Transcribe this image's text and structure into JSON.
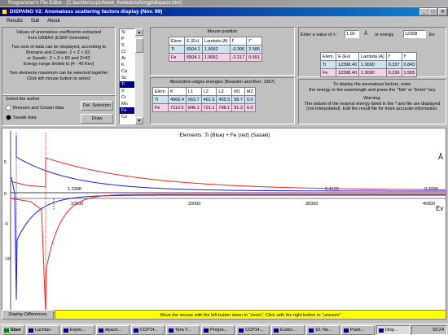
{
  "outer_window": {
    "title": "Programmer's File Editor - [C:\\lachlan\\ccp14\\web_live\\tutorial\\lmgp\\dispano.htm]"
  },
  "window": {
    "title": "DISPANO V2: Anomalous scattering factors display (Nov. 99)"
  },
  "menu": {
    "results": "Results",
    "sub": "Sub",
    "about": "About"
  },
  "info": {
    "line1": "Values of anomalous coefficients extracted",
    "line2": "from DABAX (ESRF Grenoble)",
    "line3": "Two sets of data can be displayed, according to",
    "line4": "Brenann and Cowan: 2 < Z < 92,",
    "line5": "or Sasaki : 2 < Z < 83 and Z=92",
    "line6": "Energy range limited to [4 - 40 Kev]",
    "line7": "Two elements maximum can be selected together",
    "line8": "Click left mouse button to select"
  },
  "author": {
    "label": "Select the author",
    "option1": "Brenann and Cowan data",
    "option2": "Sasaki data",
    "del_selection": "Del. Selection",
    "draw": "Draw"
  },
  "elements": [
    "Si",
    "P",
    "S",
    "Cl",
    "Ar",
    "K",
    "Ca",
    "Sc",
    "Ti",
    "V",
    "Cr",
    "Mn",
    "Fe",
    "Co"
  ],
  "mouse": {
    "label": "Mouse position",
    "headers": [
      "Elem.",
      "E (Ev)",
      "Lambda (A)",
      "f'",
      "f''"
    ],
    "rows": [
      [
        "Ti",
        "6504.1",
        "1.9062",
        "-0.306",
        "2.585"
      ],
      [
        "Fe",
        "6504.1",
        "1.9062",
        "-2.217",
        "0.551"
      ]
    ]
  },
  "edges": {
    "label": "Absorption edges energies (Bearden and Burr, 1967)",
    "headers": [
      "Elem.",
      "K",
      "L1",
      "L2",
      "L3",
      "M1",
      "M2"
    ],
    "rows": [
      [
        "Ti",
        "4966.4",
        "563.7",
        "461.5",
        "455.5",
        "58.7",
        "0.0"
      ],
      [
        "Fe",
        "7112.0",
        "846.1",
        "721.1",
        "708.1",
        "91.3",
        "0.0"
      ]
    ]
  },
  "value_input": {
    "lambda_label": "Enter a value of λ :",
    "lambda_value": "1.00",
    "unit_a": "Å",
    "or_energy": "or energy",
    "energy_value": "12398",
    "unit_ev": "Ev.",
    "headers": [
      "Elem.",
      "E (Ev)",
      "Lambda (A)",
      "f'",
      "f''"
    ],
    "rows": [
      [
        "Ti",
        "12398.40",
        "1.0000",
        "0.337",
        "0.843"
      ],
      [
        "Fe",
        "12398.40",
        "1.0000",
        "0.236",
        "1.555"
      ]
    ]
  },
  "instructions": {
    "l1": "To display the anomalous factors, enter",
    "l2": "the energy or the wavelength and press the \"Tab\" or \"Enter\" key",
    "warning": "Warning:",
    "l3": "The values of the nearest energy listed in the * ano file are displayed",
    "l4": "(not interpolated). Edit the result file for more accurate information."
  },
  "plot": {
    "title": "Elements :Ti (Blue) + Fe (red) (Sasaki)",
    "unit_a": "Å",
    "unit_ev": "Ev",
    "top_ticks": [
      "1.2398",
      "0.4133",
      "0.3099"
    ],
    "x_ticks": [
      "10000",
      "20000",
      "30000",
      "40000"
    ],
    "y_ticks": [
      "5",
      "0",
      "-5",
      "-10"
    ],
    "colors": {
      "ti": "#1a1aff",
      "fe": "#ff2020"
    }
  },
  "status": {
    "display_diff": "Display Differences",
    "message": "Move the mouse with the left button down to \"zoom\". Click with the right button to \"unzoom\""
  },
  "taskbar": {
    "start": "Start",
    "tasks": [
      "Lachlan",
      "Explo...",
      "Apach...",
      "CCP14...",
      "Tera T...",
      "Progra...",
      "CCP14...",
      "Eudor...",
      "10. No...",
      "Paint...",
      "Disp..."
    ],
    "time": "03:24"
  }
}
